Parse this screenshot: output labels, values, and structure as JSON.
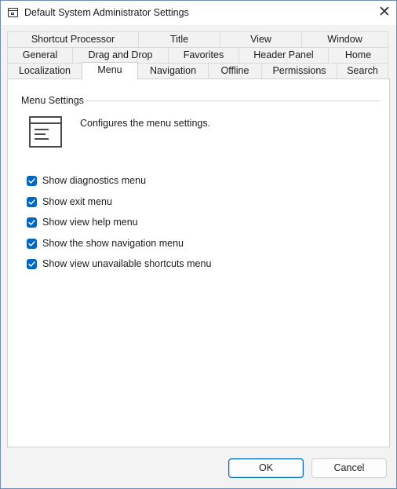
{
  "window": {
    "title": "Default System Administrator Settings",
    "close_glyph": "✕"
  },
  "tabs": {
    "row1": [
      "Shortcut Processor",
      "Title",
      "View",
      "Window"
    ],
    "row2": [
      "General",
      "Drag and Drop",
      "Favorites",
      "Header Panel",
      "Home"
    ],
    "row3": [
      "Localization",
      "Menu",
      "Navigation",
      "Offline",
      "Permissions",
      "Search"
    ],
    "active": "Menu"
  },
  "panel": {
    "group_label": "Menu Settings",
    "icon": "menu-settings-icon",
    "description": "Configures the menu settings.",
    "options": [
      {
        "label": "Show diagnostics menu",
        "checked": true
      },
      {
        "label": "Show exit menu",
        "checked": true
      },
      {
        "label": "Show view help menu",
        "checked": true
      },
      {
        "label": "Show the show navigation menu",
        "checked": true
      },
      {
        "label": "Show view unavailable shortcuts menu",
        "checked": true
      }
    ]
  },
  "buttons": {
    "ok": "OK",
    "cancel": "Cancel"
  },
  "colors": {
    "accent": "#0067c0",
    "window_bg": "#f3f3f3",
    "panel_bg": "#ffffff"
  }
}
